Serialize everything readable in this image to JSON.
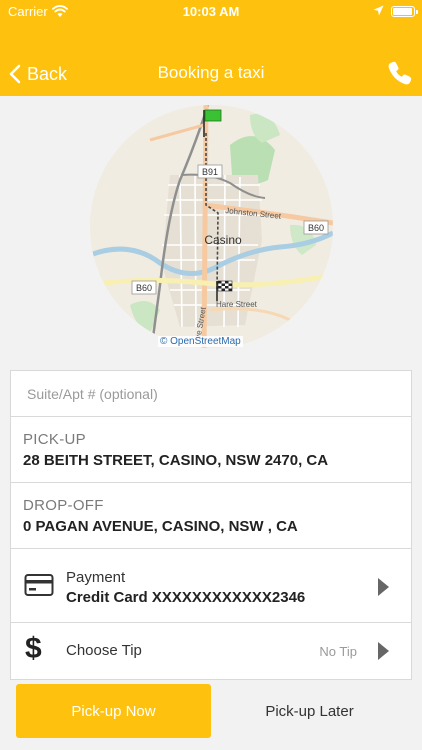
{
  "status_bar": {
    "carrier": "Carrier",
    "time": "10:03 AM"
  },
  "nav": {
    "back_label": "Back",
    "title": "Booking a taxi",
    "phone_icon": "phone-icon"
  },
  "map": {
    "town_label": "Casino",
    "road_labels": [
      "B91",
      "B60",
      "B60",
      "Johnston Street",
      "Hare Street",
      "ive Street"
    ],
    "attribution": "© OpenStreetMap",
    "markers": [
      "start-flag-icon",
      "finish-flag-icon"
    ]
  },
  "form": {
    "suite_placeholder": "Suite/Apt # (optional)",
    "pickup_label": "PICK-UP",
    "pickup_value": "28 BEITH STREET, CASINO, NSW 2470, CA",
    "dropoff_label": "DROP-OFF",
    "dropoff_value": "0 PAGAN AVENUE, CASINO, NSW , CA",
    "payment_label": "Payment",
    "payment_value": "Credit Card XXXXXXXXXXXX2346",
    "tip_symbol": "$",
    "tip_label": "Choose Tip",
    "tip_value": "No Tip"
  },
  "actions": {
    "pickup_now": "Pick-up Now",
    "pickup_later": "Pick-up Later"
  },
  "colors": {
    "accent": "#fec20e"
  }
}
